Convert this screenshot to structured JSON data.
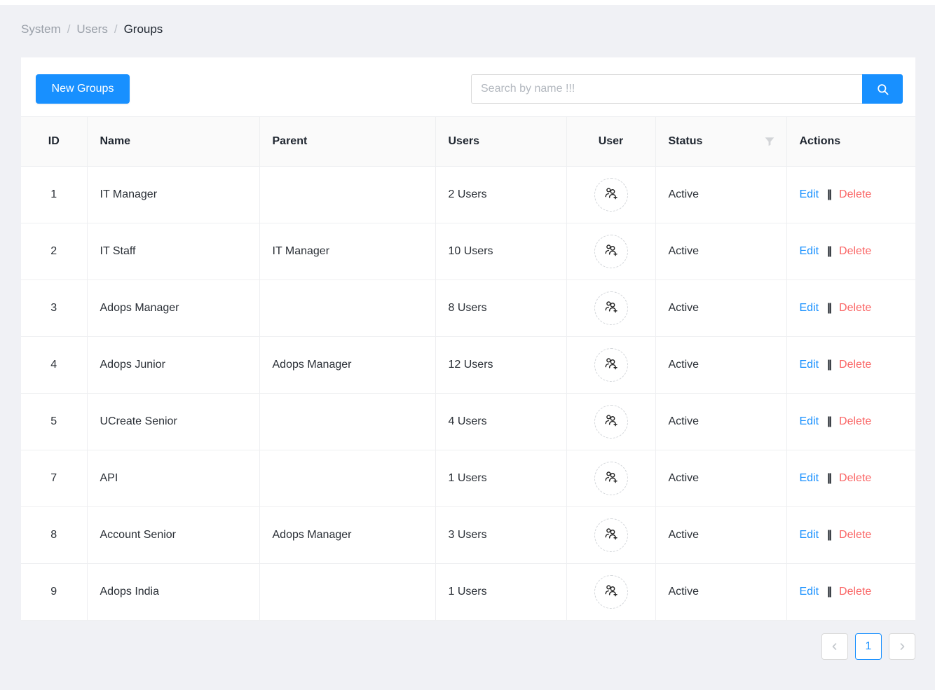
{
  "breadcrumb": {
    "items": [
      {
        "label": "System",
        "current": false
      },
      {
        "label": "Users",
        "current": false
      },
      {
        "label": "Groups",
        "current": true
      }
    ],
    "separator": "/"
  },
  "toolbar": {
    "new_button_label": "New Groups",
    "search_placeholder": "Search by name !!!",
    "search_value": "",
    "search_icon": "search-icon"
  },
  "table": {
    "columns": [
      {
        "key": "id",
        "label": "ID"
      },
      {
        "key": "name",
        "label": "Name"
      },
      {
        "key": "parent",
        "label": "Parent"
      },
      {
        "key": "users",
        "label": "Users"
      },
      {
        "key": "user",
        "label": "User"
      },
      {
        "key": "status",
        "label": "Status",
        "filter_icon": "filter-icon"
      },
      {
        "key": "actions",
        "label": "Actions"
      }
    ],
    "rows": [
      {
        "id": "1",
        "name": "IT Manager",
        "parent": "",
        "users": "2 Users",
        "user_icon": "user-add-icon",
        "status": "Active",
        "edit": "Edit",
        "separator": "||",
        "delete": "Delete"
      },
      {
        "id": "2",
        "name": "IT Staff",
        "parent": "IT Manager",
        "users": "10 Users",
        "user_icon": "user-add-icon",
        "status": "Active",
        "edit": "Edit",
        "separator": "||",
        "delete": "Delete"
      },
      {
        "id": "3",
        "name": "Adops Manager",
        "parent": "",
        "users": "8 Users",
        "user_icon": "user-add-icon",
        "status": "Active",
        "edit": "Edit",
        "separator": "||",
        "delete": "Delete"
      },
      {
        "id": "4",
        "name": "Adops Junior",
        "parent": "Adops Manager",
        "users": "12 Users",
        "user_icon": "user-add-icon",
        "status": "Active",
        "edit": "Edit",
        "separator": "||",
        "delete": "Delete"
      },
      {
        "id": "5",
        "name": "UCreate Senior",
        "parent": "",
        "users": "4 Users",
        "user_icon": "user-add-icon",
        "status": "Active",
        "edit": "Edit",
        "separator": "||",
        "delete": "Delete"
      },
      {
        "id": "7",
        "name": "API",
        "parent": "",
        "users": "1 Users",
        "user_icon": "user-add-icon",
        "status": "Active",
        "edit": "Edit",
        "separator": "||",
        "delete": "Delete"
      },
      {
        "id": "8",
        "name": "Account Senior",
        "parent": "Adops Manager",
        "users": "3 Users",
        "user_icon": "user-add-icon",
        "status": "Active",
        "edit": "Edit",
        "separator": "||",
        "delete": "Delete"
      },
      {
        "id": "9",
        "name": "Adops India",
        "parent": "",
        "users": "1 Users",
        "user_icon": "user-add-icon",
        "status": "Active",
        "edit": "Edit",
        "separator": "||",
        "delete": "Delete"
      }
    ]
  },
  "pagination": {
    "prev_icon": "chevron-left-icon",
    "next_icon": "chevron-right-icon",
    "pages": [
      {
        "label": "1",
        "active": true
      }
    ],
    "current_page": "1"
  },
  "colors": {
    "accent": "#1890ff",
    "delete": "#fa6464",
    "page_background": "#f0f1f5",
    "card_background": "#ffffff",
    "header_background": "#fafafa",
    "border": "#eeeff1"
  }
}
